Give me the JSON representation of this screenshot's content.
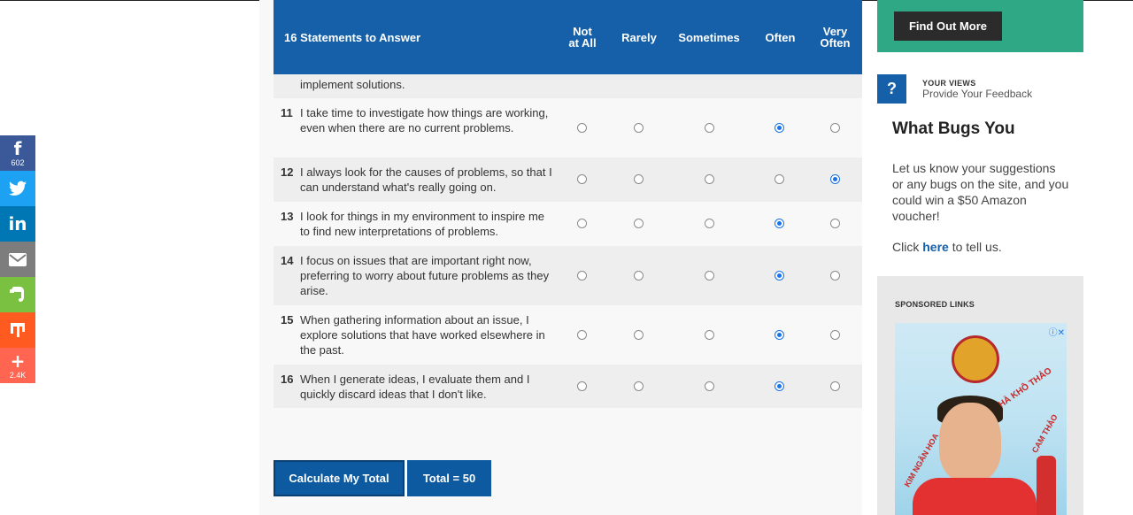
{
  "social": {
    "facebook_count": "602",
    "more_count": "2.4K",
    "icons": [
      "facebook-icon",
      "twitter-icon",
      "linkedin-icon",
      "email-icon",
      "evernote-icon",
      "mix-icon",
      "plus-icon"
    ],
    "glyphs": {
      "facebook": "f",
      "linkedin": "in",
      "plus": "+"
    }
  },
  "table": {
    "title": "16 Statements to Answer",
    "columns": [
      "Not\nat All",
      "Rarely",
      "Sometimes",
      "Often",
      "Very\nOften"
    ],
    "partial_row_text": "implement solutions.",
    "rows": [
      {
        "num": "11",
        "text": "I take time to investigate how things are working, even when there are no current problems.",
        "selected": 3
      },
      {
        "num": "12",
        "text": "I always look for the causes of problems, so that I can understand what's really going on.",
        "selected": 4
      },
      {
        "num": "13",
        "text": "I look for things in my environment to inspire me to find new interpretations of problems.",
        "selected": 3
      },
      {
        "num": "14",
        "text": "I focus on issues that are important right now, preferring to worry about future problems as they arise.",
        "selected": 3
      },
      {
        "num": "15",
        "text": "When gathering information about an issue, I explore solutions that have worked elsewhere in the past.",
        "selected": 3
      },
      {
        "num": "16",
        "text": "When I generate ideas, I evaluate them and I quickly discard ideas that I don't like.",
        "selected": 3
      }
    ]
  },
  "actions": {
    "calculate_label": "Calculate My Total",
    "total_label": "Total = 50"
  },
  "sidebar": {
    "find_out_label": "Find Out More",
    "question_mark": "?",
    "your_views": "YOUR VIEWS",
    "feedback": "Provide Your Feedback",
    "heading": "What Bugs You",
    "body": "Let us know your suggestions or any bugs on the site, and you could win a $50 Amazon voucher!",
    "click_prefix": "Click ",
    "click_link": "here",
    "click_suffix": " to tell us.",
    "sponsored": "SPONSORED LINKS",
    "ad_text": [
      "HÀ KHÔ THẢO",
      "CAM THẢO",
      "KIM NGÂN HOA"
    ],
    "ad_choices_glyph": "ⓘ✕"
  },
  "colors": {
    "header_blue": "#1560a8",
    "promo_green": "#2fa886",
    "radio_selected": "#1a73e8"
  }
}
